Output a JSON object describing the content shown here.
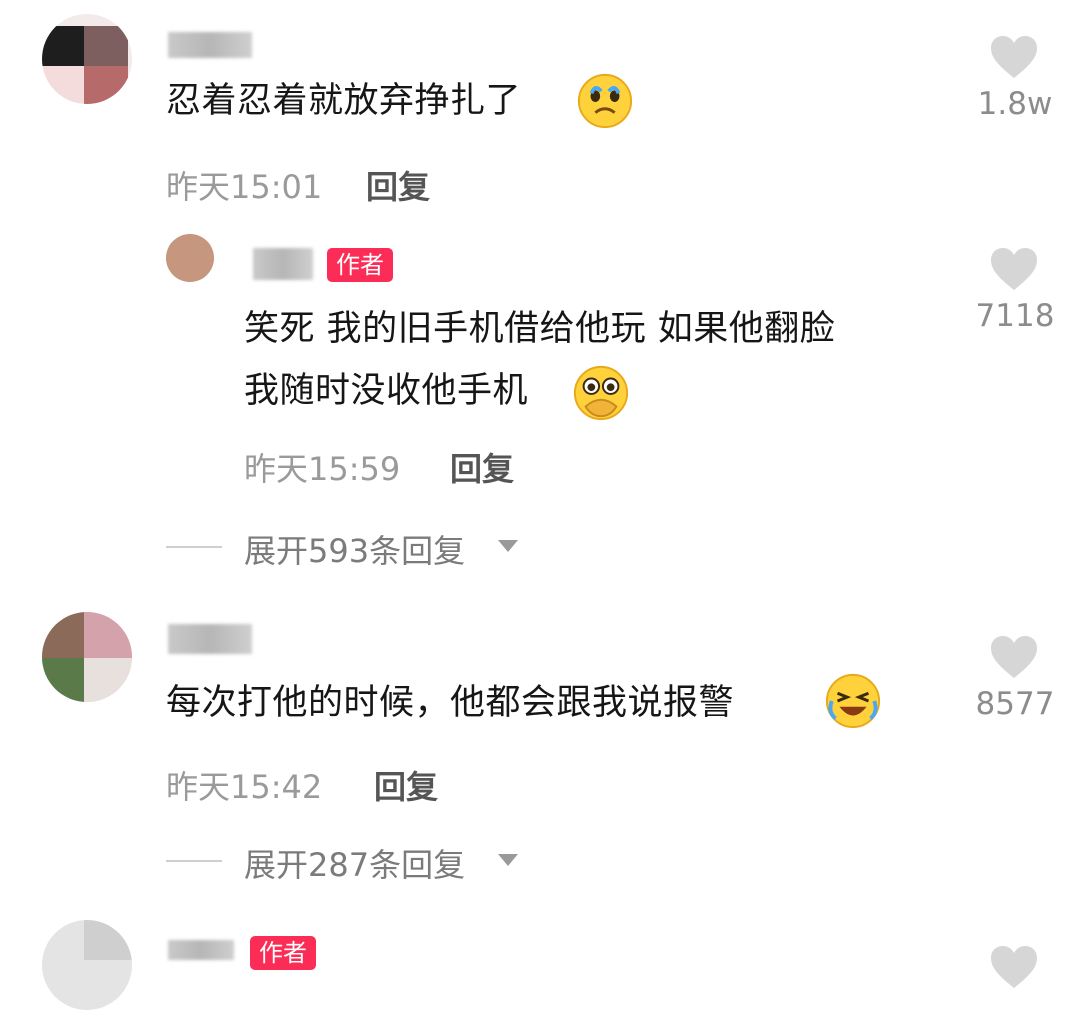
{
  "comments": [
    {
      "text": "忍着忍着就放弃挣扎了",
      "time": "昨天15:01",
      "reply_label": "回复",
      "likes": "1.8w",
      "emoji": "crying-face-emoji"
    },
    {
      "author_badge": "作者",
      "text_line1": "笑死 我的旧手机借给他玩 如果他翻脸",
      "text_line2": "我随时没收他手机",
      "time": "昨天15:59",
      "reply_label": "回复",
      "likes": "7118",
      "emoji": "hand-over-mouth-teary-emoji"
    },
    {
      "expand_label": "展开593条回复"
    },
    {
      "text": "每次打他的时候，他都会跟我说报警",
      "time": "昨天15:42",
      "reply_label": "回复",
      "likes": "8577",
      "emoji": "rolling-laughing-emoji"
    },
    {
      "expand_label": "展开287条回复"
    },
    {
      "author_badge": "作者"
    }
  ],
  "icons": {
    "like": "heart-icon",
    "expand": "triangle-down-icon"
  },
  "colors": {
    "badge": "#fb2c55",
    "heart": "#d6d6d6",
    "muted_text": "#9a9a9a"
  }
}
